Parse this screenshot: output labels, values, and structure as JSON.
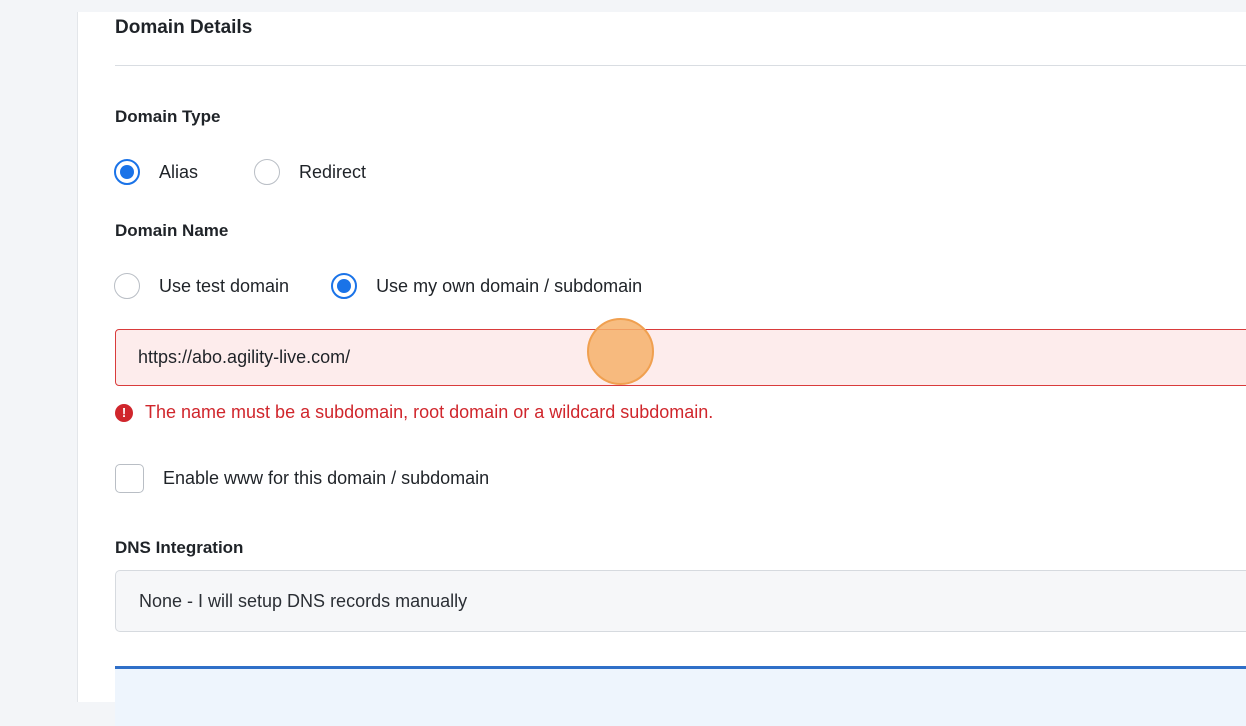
{
  "section": {
    "title": "Domain Details"
  },
  "domain_type": {
    "label": "Domain Type",
    "options": [
      {
        "label": "Alias",
        "checked": true
      },
      {
        "label": "Redirect",
        "checked": false
      }
    ]
  },
  "domain_name": {
    "label": "Domain Name",
    "options": [
      {
        "label": "Use test domain",
        "checked": false
      },
      {
        "label": "Use my own domain / subdomain",
        "checked": true
      }
    ],
    "input_value": "https://abo.agility-live.com/",
    "error_message": "The name must be a subdomain, root domain or a wildcard subdomain.",
    "error_icon": "exclamation-circle-icon"
  },
  "www_option": {
    "label": "Enable www for this domain / subdomain",
    "checked": false
  },
  "dns_integration": {
    "label": "DNS Integration",
    "selected": "None - I will setup DNS records manually"
  },
  "colors": {
    "accent": "#1a73e8",
    "error": "#d0262c",
    "error_bg": "#fdecec",
    "info_border": "#2f6fc8"
  }
}
